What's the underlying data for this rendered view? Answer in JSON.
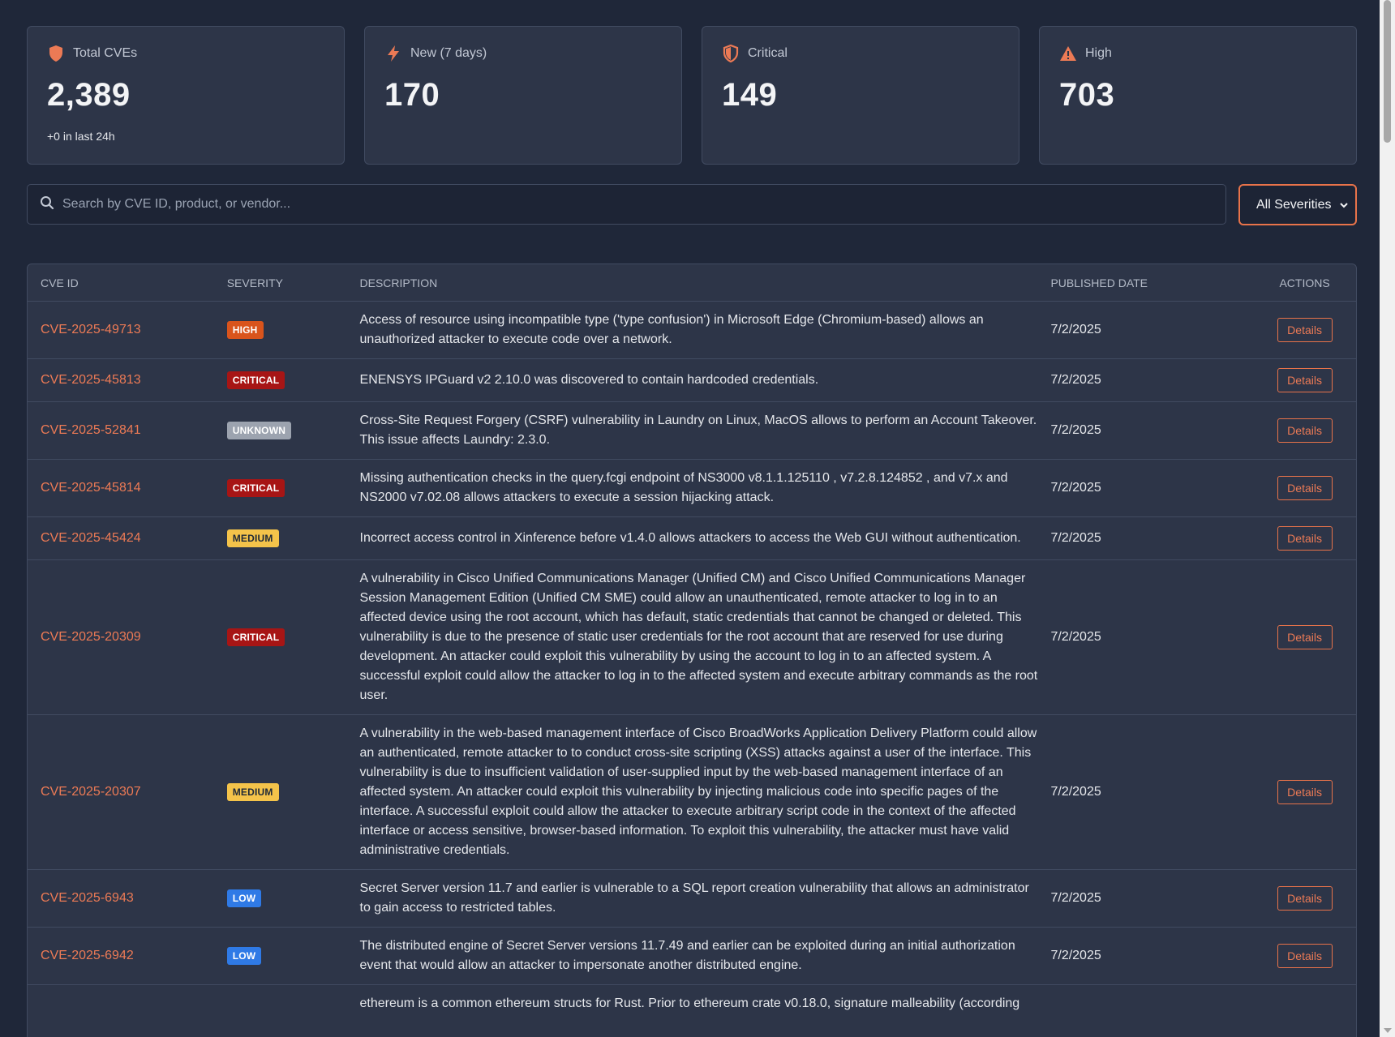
{
  "stats": [
    {
      "label": "Total CVEs",
      "value": "2,389",
      "sub": "+0 in last 24h",
      "icon": "shield-icon"
    },
    {
      "label": "New (7 days)",
      "value": "170",
      "sub": "",
      "icon": "bolt-icon"
    },
    {
      "label": "Critical",
      "value": "149",
      "sub": "",
      "icon": "shield-half-icon"
    },
    {
      "label": "High",
      "value": "703",
      "sub": "",
      "icon": "warning-icon"
    }
  ],
  "search": {
    "placeholder": "Search by CVE ID, product, or vendor...",
    "value": ""
  },
  "filter": {
    "selected": "All Severities"
  },
  "table": {
    "headers": {
      "id": "CVE ID",
      "severity": "SEVERITY",
      "description": "DESCRIPTION",
      "date": "PUBLISHED DATE",
      "actions": "ACTIONS"
    },
    "details_label": "Details",
    "rows": [
      {
        "id": "CVE-2025-49713",
        "severity": "HIGH",
        "date": "7/2/2025",
        "description": "Access of resource using incompatible type ('type confusion') in Microsoft Edge (Chromium-based) allows an unauthorized attacker to execute code over a network."
      },
      {
        "id": "CVE-2025-45813",
        "severity": "CRITICAL",
        "date": "7/2/2025",
        "description": "ENENSYS IPGuard v2 2.10.0 was discovered to contain hardcoded credentials."
      },
      {
        "id": "CVE-2025-52841",
        "severity": "UNKNOWN",
        "date": "7/2/2025",
        "description": "Cross-Site Request Forgery (CSRF) vulnerability in Laundry on Linux, MacOS allows to perform an Account Takeover. This issue affects Laundry: 2.3.0."
      },
      {
        "id": "CVE-2025-45814",
        "severity": "CRITICAL",
        "date": "7/2/2025",
        "description": "Missing authentication checks in the query.fcgi endpoint of NS3000 v8.1.1.125110 , v7.2.8.124852 , and v7.x and NS2000 v7.02.08 allows attackers to execute a session hijacking attack."
      },
      {
        "id": "CVE-2025-45424",
        "severity": "MEDIUM",
        "date": "7/2/2025",
        "description": "Incorrect access control in Xinference before v1.4.0 allows attackers to access the Web GUI without authentication."
      },
      {
        "id": "CVE-2025-20309",
        "severity": "CRITICAL",
        "date": "7/2/2025",
        "description": "A vulnerability in Cisco Unified Communications Manager (Unified CM) and Cisco Unified Communications Manager Session Management Edition (Unified CM SME) could allow an unauthenticated, remote attacker to log in to an affected device using the root account, which has default, static credentials that cannot be changed or deleted. This vulnerability is due to the presence of static user credentials for the root account that are reserved for use during development. An attacker could exploit this vulnerability by using the account to log in to an affected system. A successful exploit could allow the attacker to log in to the affected system and execute arbitrary commands as the root user."
      },
      {
        "id": "CVE-2025-20307",
        "severity": "MEDIUM",
        "date": "7/2/2025",
        "description": "A vulnerability in the web-based management interface of Cisco BroadWorks Application Delivery Platform could allow an authenticated, remote attacker to to conduct cross-site scripting (XSS) attacks against a user of the interface. This vulnerability is due to insufficient validation of user-supplied input by the web-based management interface of an affected system. An attacker could exploit this vulnerability by injecting malicious code into specific pages of the interface. A successful exploit could allow the attacker to execute arbitrary script code in the context of the affected interface or access sensitive, browser-based information. To exploit this vulnerability, the attacker must have valid administrative credentials."
      },
      {
        "id": "CVE-2025-6943",
        "severity": "LOW",
        "date": "7/2/2025",
        "description": "Secret Server version 11.7 and earlier is vulnerable to a SQL report creation vulnerability that allows an administrator to gain access to restricted tables."
      },
      {
        "id": "CVE-2025-6942",
        "severity": "LOW",
        "date": "7/2/2025",
        "description": "The distributed engine of Secret Server versions 11.7.49 and earlier can be exploited during an initial authorization event that would allow an attacker to impersonate another distributed engine."
      },
      {
        "id": "",
        "severity": "",
        "date": "",
        "description": "ethereum is a common ethereum structs for Rust. Prior to ethereum crate v0.18.0, signature malleability (according"
      }
    ]
  },
  "colors": {
    "accent": "#ec7a55",
    "background": "#1f2739",
    "card": "#2d3548",
    "high": "#d9541c",
    "critical": "#a71515",
    "medium": "#f4c34a",
    "low": "#2f7ae6",
    "unknown": "#9ca3af"
  }
}
